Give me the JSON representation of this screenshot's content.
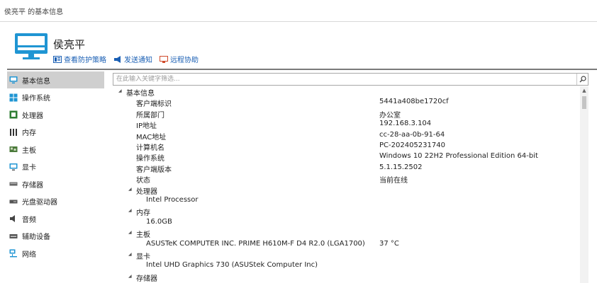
{
  "window": {
    "title": "侯亮平 的基本信息"
  },
  "header": {
    "name": "侯亮平",
    "links": [
      {
        "label": "查看防护策略"
      },
      {
        "label": "发送通知"
      },
      {
        "label": "远程协助"
      }
    ]
  },
  "sidebar": {
    "items": [
      {
        "label": "基本信息"
      },
      {
        "label": "操作系统"
      },
      {
        "label": "处理器"
      },
      {
        "label": "内存"
      },
      {
        "label": "主板"
      },
      {
        "label": "显卡"
      },
      {
        "label": "存储器"
      },
      {
        "label": "光盘驱动器"
      },
      {
        "label": "音频"
      },
      {
        "label": "辅助设备"
      },
      {
        "label": "网络"
      }
    ]
  },
  "search": {
    "placeholder": "在此输入关键字筛选..."
  },
  "tree": {
    "basic": {
      "title": "基本信息",
      "rows": [
        {
          "key": "客户端标识",
          "value": "5441a408be1720cf"
        },
        {
          "key": "所属部门",
          "value": "办公室"
        },
        {
          "key": "IP地址",
          "value": "192.168.3.104"
        },
        {
          "key": "MAC地址",
          "value": "cc-28-aa-0b-91-64"
        },
        {
          "key": "计算机名",
          "value": "PC-202405231740"
        },
        {
          "key": "操作系统",
          "value": "Windows 10 22H2 Professional Edition 64-bit"
        },
        {
          "key": "客户端版本",
          "value": "5.1.15.2502"
        },
        {
          "key": "状态",
          "value": "当前在线"
        }
      ]
    },
    "cpu": {
      "title": "处理器",
      "value": "Intel Processor"
    },
    "memory": {
      "title": "内存",
      "value": "16.0GB"
    },
    "board": {
      "title": "主板",
      "value": "ASUSTeK COMPUTER INC. PRIME H610M-F D4 R2.0 (LGA1700)",
      "temp": "37 °C"
    },
    "gpu": {
      "title": "显卡",
      "value": "Intel UHD Graphics 730 (ASUStek Computer Inc)"
    },
    "storage": {
      "title": "存储器"
    }
  }
}
